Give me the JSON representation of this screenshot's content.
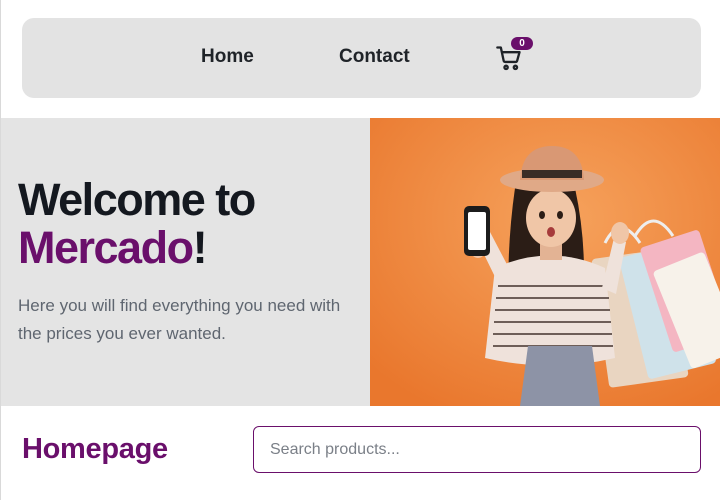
{
  "nav": {
    "home_label": "Home",
    "contact_label": "Contact",
    "cart_icon": "shopping-cart-icon",
    "cart_count": "0"
  },
  "hero": {
    "title_line1": "Welcome to",
    "title_brand": "Mercado",
    "title_punct": "!",
    "subtitle": "Here you will find everything you need with the prices you ever wanted."
  },
  "section": {
    "heading": "Homepage"
  },
  "search": {
    "placeholder": "Search products..."
  },
  "colors": {
    "brand": "#6a0f6b",
    "navbar_bg": "#e3e3e3",
    "hero_bg": "#e4e4e4",
    "hero_image_bg": "#f08a3e"
  }
}
